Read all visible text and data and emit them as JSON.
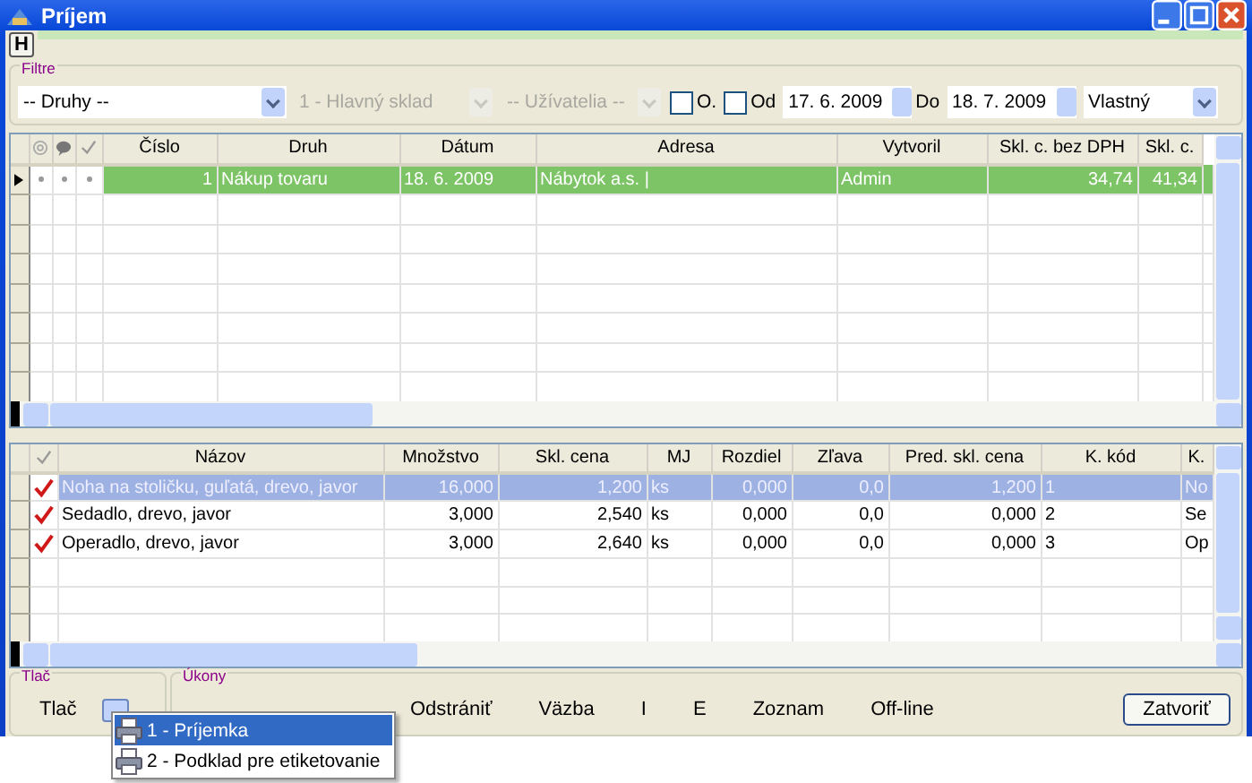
{
  "window": {
    "title": "Príjem"
  },
  "menu": {
    "label": "H"
  },
  "filters": {
    "title": "Filtre",
    "kind_combo": {
      "value": "-- Druhy --",
      "disabled": false
    },
    "store_combo": {
      "value": "1 - Hlavný sklad",
      "disabled": true
    },
    "user_combo": {
      "value": "-- Užívatelia --",
      "disabled": true
    },
    "o_check": {
      "label": "O.",
      "checked": false
    },
    "from_check": {
      "label": "Od",
      "checked": false
    },
    "from_date": "17. 6. 2009",
    "to_label": "Do",
    "to_date": "18. 7. 2009",
    "period_combo": {
      "value": "Vlastný",
      "disabled": false
    }
  },
  "receipts": {
    "columns": [
      {
        "kind": "icon"
      },
      {
        "kind": "icon"
      },
      {
        "kind": "icon"
      },
      {
        "kind": "text",
        "label": "Číslo"
      },
      {
        "kind": "text",
        "label": "Druh"
      },
      {
        "kind": "text",
        "label": "Dátum"
      },
      {
        "kind": "text",
        "label": "Adresa"
      },
      {
        "kind": "text",
        "label": "Vytvoril"
      },
      {
        "kind": "text",
        "label": "Skl. c. bez DPH"
      },
      {
        "kind": "text",
        "label": "Skl. c."
      }
    ],
    "rows": [
      {
        "selected": true,
        "cells": [
          "",
          "",
          "",
          "1",
          "Nákup tovaru",
          "18. 6. 2009",
          "Nábytok a.s. |",
          "Admin",
          "34,74",
          "41,34"
        ]
      }
    ]
  },
  "items": {
    "columns": [
      "Názov",
      "Množstvo",
      "Skl. cena",
      "MJ",
      "Rozdiel",
      "Zľava",
      "Pred. skl. cena",
      "K. kód",
      "K."
    ],
    "rows": [
      {
        "selected": true,
        "checked": true,
        "cells": [
          "Noha na stoličku, guľatá, drevo, javor",
          "16,000",
          "1,200",
          "ks",
          "0,000",
          "0,0",
          "1,200",
          "1",
          "No"
        ]
      },
      {
        "selected": false,
        "checked": true,
        "cells": [
          "Sedadlo, drevo, javor",
          "3,000",
          "2,540",
          "ks",
          "0,000",
          "0,0",
          "0,000",
          "2",
          "Se"
        ]
      },
      {
        "selected": false,
        "checked": true,
        "cells": [
          "Operadlo, drevo, javor",
          "3,000",
          "2,640",
          "ks",
          "0,000",
          "0,0",
          "0,000",
          "3",
          "Op"
        ]
      }
    ]
  },
  "print_group": {
    "title": "Tlač",
    "button": "Tlač"
  },
  "actions_group": {
    "title": "Úkony",
    "buttons": [
      "Odstrániť",
      "Väzba",
      "I",
      "E",
      "Zoznam",
      "Off-line"
    ]
  },
  "close_button": "Zatvoriť",
  "print_menu": [
    {
      "label": "1 - Príjemka",
      "selected": true
    },
    {
      "label": "2 - Podklad pre etiketovanie",
      "selected": false
    }
  ]
}
